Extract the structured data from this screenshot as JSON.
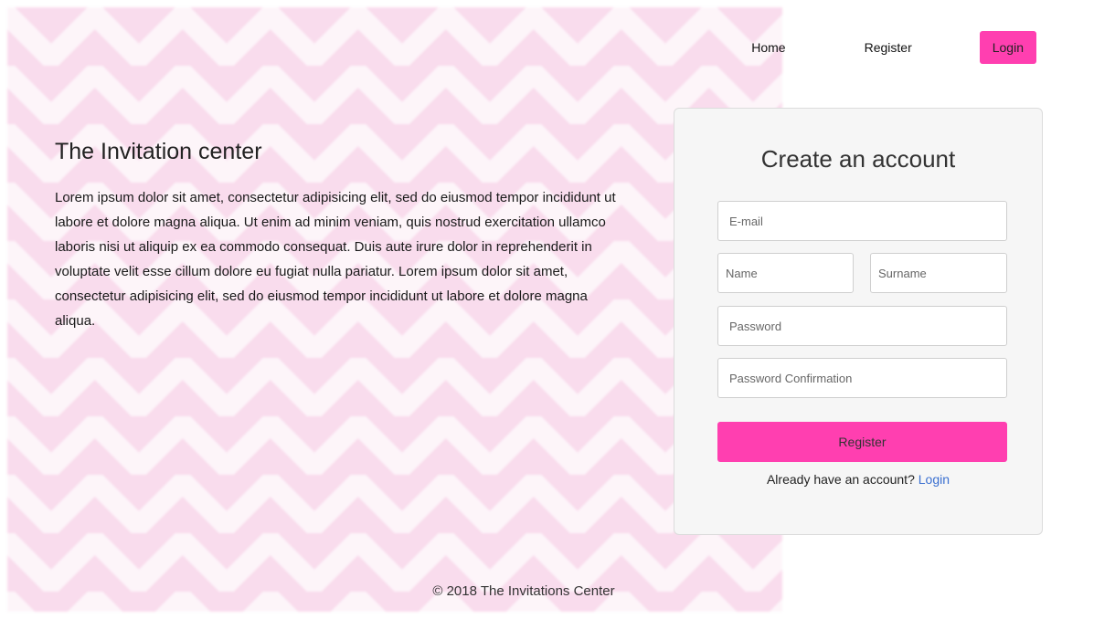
{
  "nav": {
    "home_label": "Home",
    "register_label": "Register",
    "login_label": "Login"
  },
  "intro": {
    "title": "The Invitation center",
    "body": "Lorem ipsum dolor sit amet, consectetur adipisicing elit, sed do eiusmod tempor incididunt ut labore et dolore magna aliqua. Ut enim ad minim veniam, quis nostrud exercitation ullamco laboris nisi ut aliquip ex ea commodo consequat. Duis aute irure dolor in reprehenderit in voluptate velit esse cillum dolore eu fugiat nulla pariatur. Lorem ipsum dolor sit amet, consectetur adipisicing elit, sed do eiusmod tempor incididunt ut labore et dolore magna aliqua."
  },
  "form": {
    "title": "Create an account",
    "email_placeholder": "E-mail",
    "name_placeholder": "Name",
    "surname_placeholder": "Surname",
    "password_placeholder": "Password",
    "password_confirm_placeholder": "Password Confirmation",
    "submit_label": "Register",
    "already_text": "Already have an account?",
    "login_link": "Login"
  },
  "footer": {
    "text": "© 2018 The Invitations Center"
  },
  "colors": {
    "accent": "#ff3fb0",
    "link": "#3a6fd0",
    "chevron": "#f9d6ea"
  }
}
